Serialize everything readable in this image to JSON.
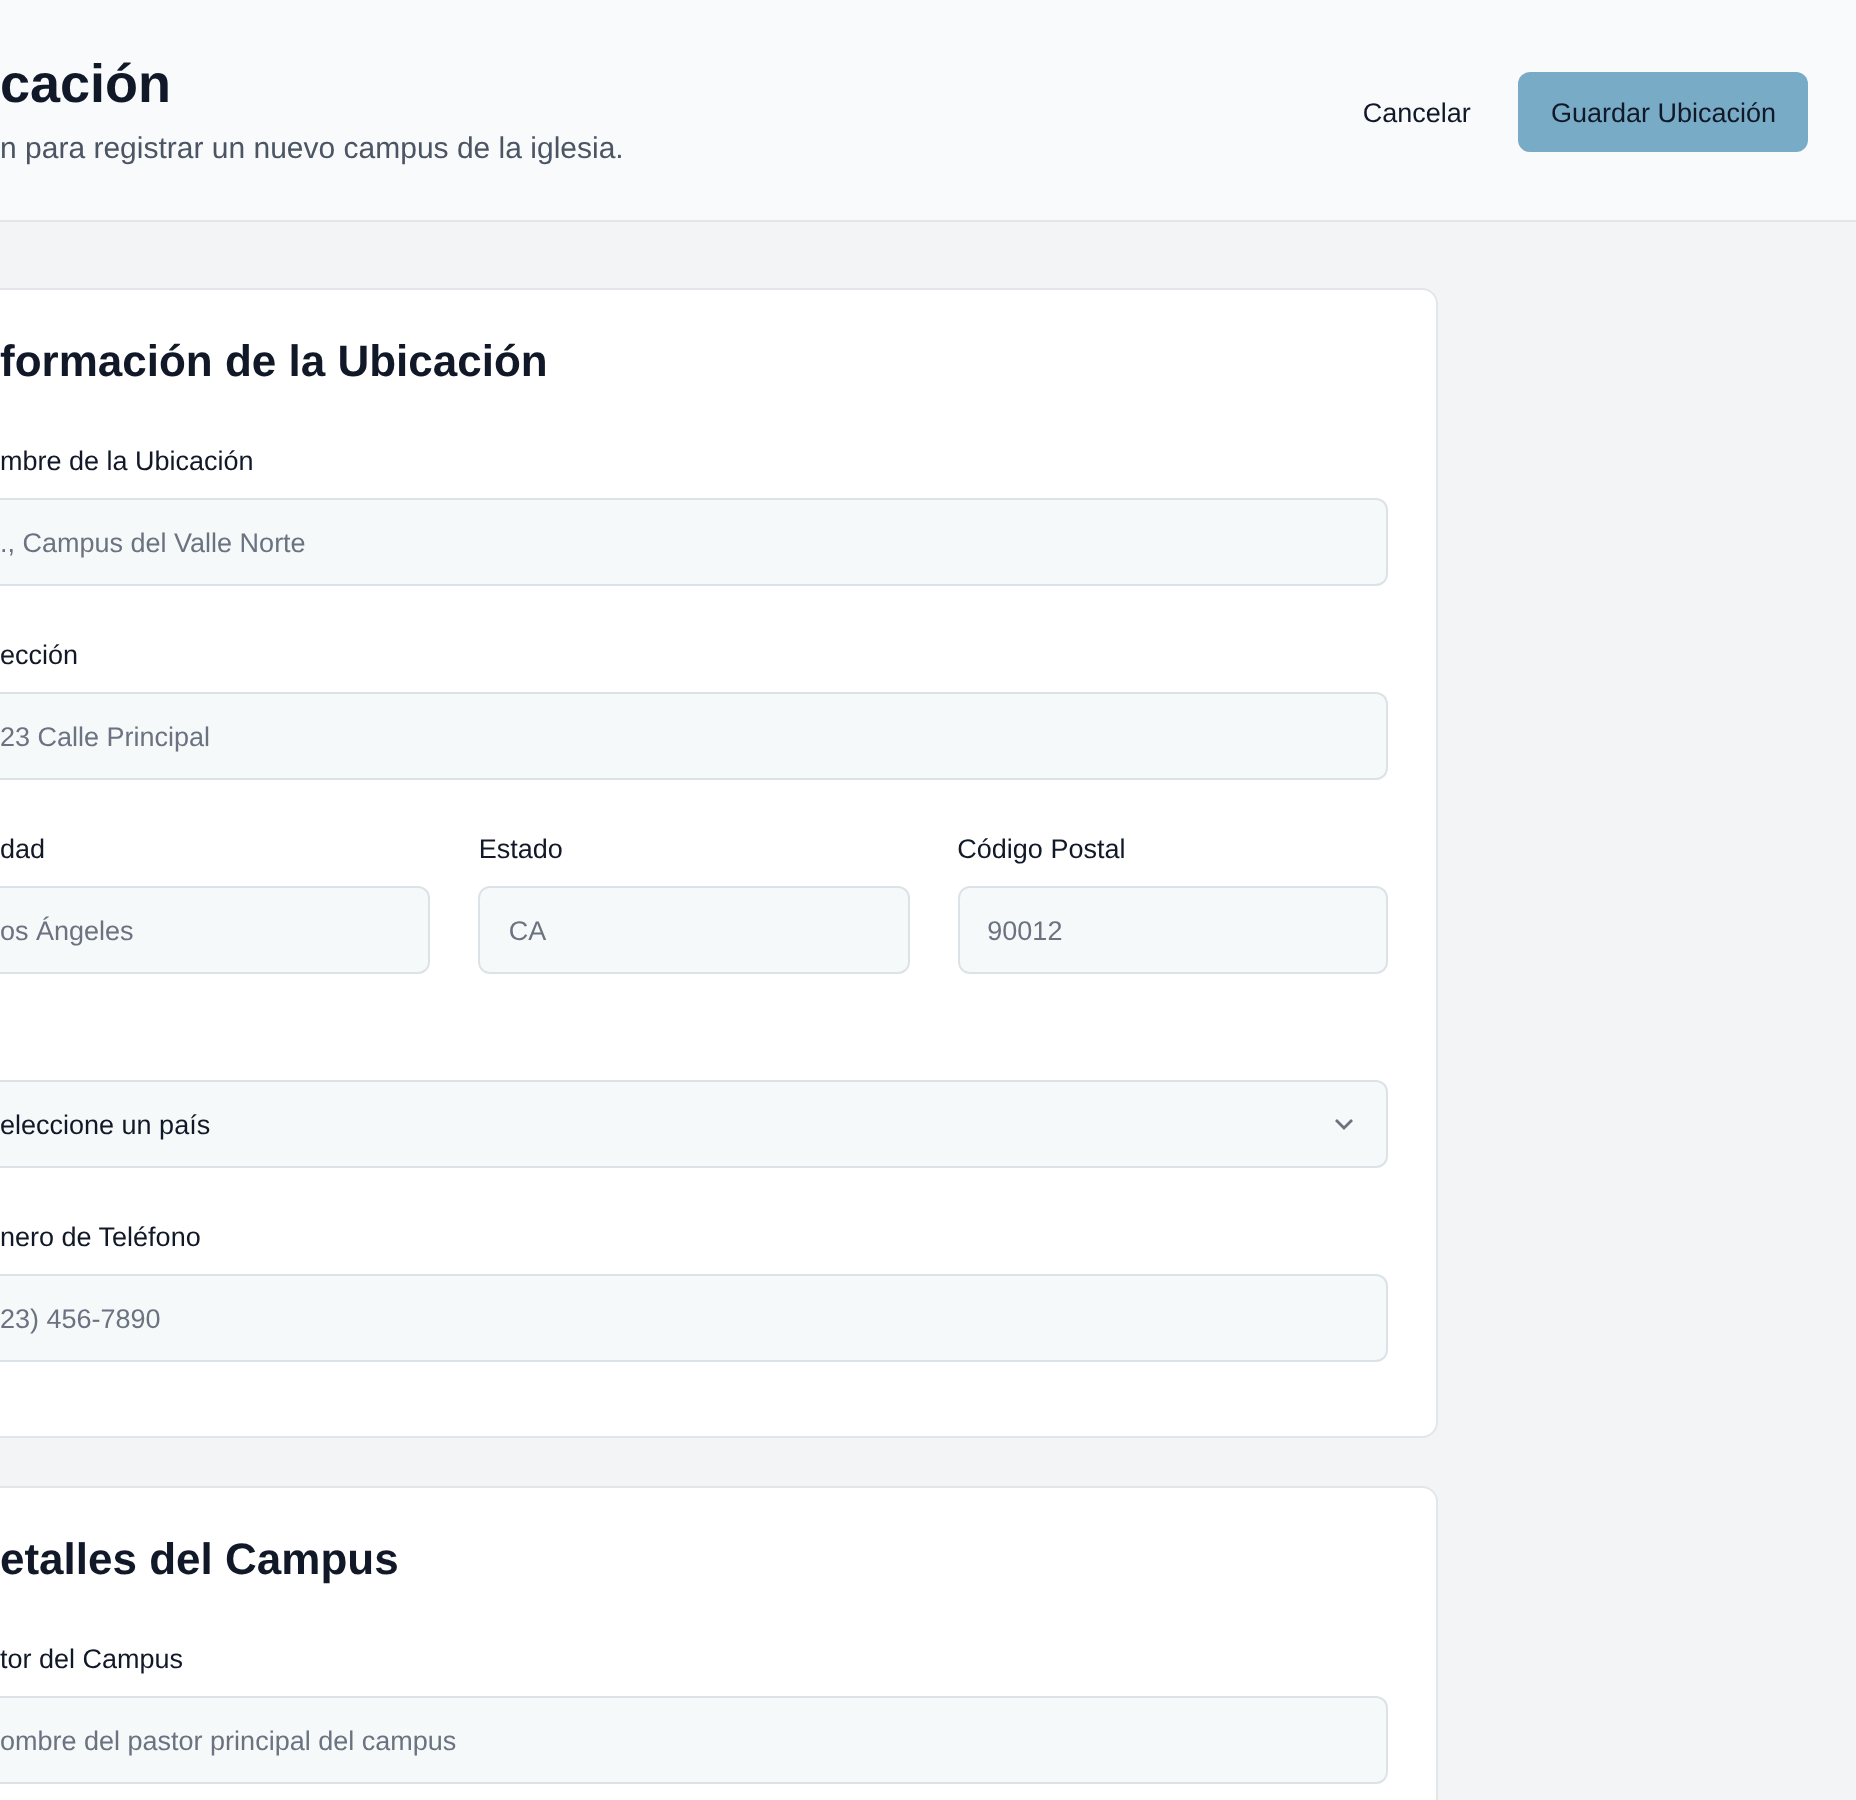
{
  "header": {
    "title": "cación",
    "subtitle": "n para registrar un nuevo campus de la iglesia.",
    "cancel": "Cancelar",
    "save": "Guardar Ubicación"
  },
  "sections": [
    {
      "title": "formación de la Ubicación",
      "fields": [
        {
          "kind": "text",
          "label": "mbre de la Ubicación",
          "placeholder": "., Campus del Valle Norte"
        },
        {
          "kind": "text",
          "label": "ección",
          "placeholder": "23 Calle Principal"
        },
        {
          "kind": "group",
          "fields": [
            {
              "kind": "text",
              "label": "dad",
              "placeholder": "os Ángeles"
            },
            {
              "kind": "text",
              "label": "Estado",
              "placeholder": "CA"
            },
            {
              "kind": "text",
              "label": "Código Postal",
              "placeholder": "90012"
            }
          ]
        },
        {
          "kind": "select",
          "value": "eleccione un país"
        },
        {
          "kind": "text",
          "label": "nero de Teléfono",
          "placeholder": "23) 456-7890"
        }
      ]
    },
    {
      "title": "etalles del Campus",
      "fields": [
        {
          "kind": "text",
          "label": "tor del Campus",
          "placeholder": "ombre del pastor principal del campus"
        }
      ]
    }
  ]
}
